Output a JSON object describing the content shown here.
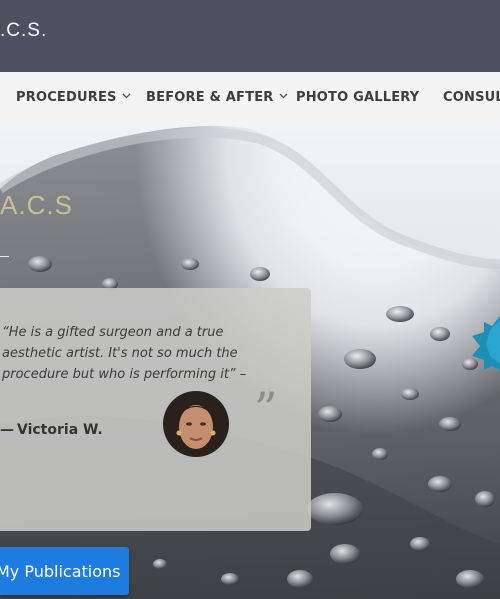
{
  "site": {
    "title": ".C.S.",
    "hero_heading": "A.C.S"
  },
  "nav": {
    "items": [
      {
        "label": "PROCEDURES",
        "has_dropdown": true
      },
      {
        "label": "BEFORE & AFTER",
        "has_dropdown": true
      },
      {
        "label": "PHOTO GALLERY",
        "has_dropdown": false
      },
      {
        "label": "CONSULT",
        "has_dropdown": false
      }
    ],
    "dropdown_icon": "chevron-down-icon"
  },
  "testimonial": {
    "quote": "“He is a gifted surgeon and a true aesthetic artist. It's not so much the procedure but who is performing it” –",
    "author_dash": "—",
    "author": "Victoria W.",
    "quote_icon": "closing-quote-icon"
  },
  "cta": {
    "label": "My Publications"
  },
  "colors": {
    "topbar": "#4a5161",
    "nav_bg": "#f4f4f4",
    "button": "#1e7be0",
    "badge": "#1d8fb5",
    "heading": "#c7c090"
  }
}
